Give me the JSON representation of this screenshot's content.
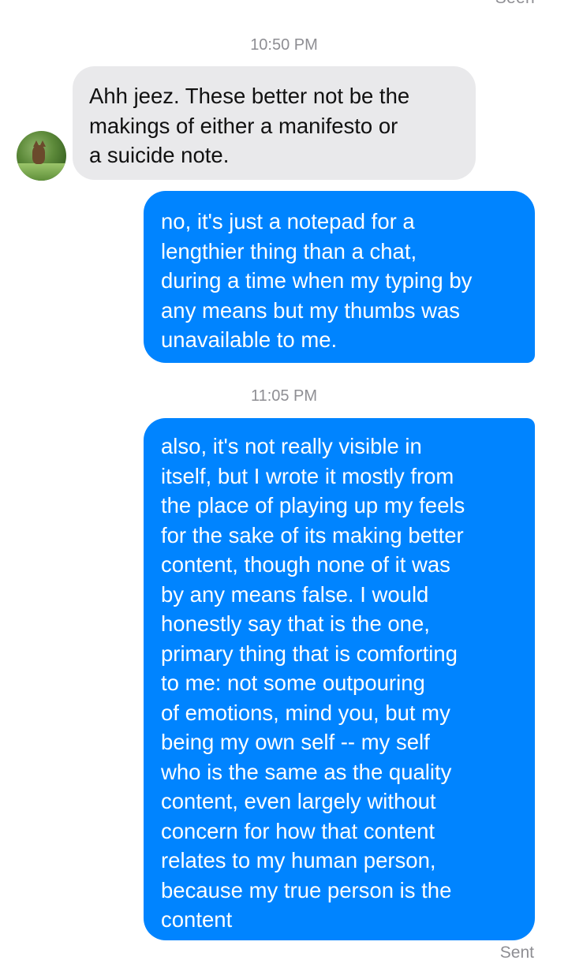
{
  "header": {
    "status_top": "Seen"
  },
  "thread": {
    "timestamp_1": "10:50 PM",
    "incoming_message": "Ahh jeez. These better not be the\nmakings of either a manifesto or\na suicide note.",
    "outgoing_message_1": "no, it's just a notepad for a\nlengthier thing than a chat,\nduring a time when my typing by\nany means but my thumbs was\nunavailable to me.",
    "timestamp_2": "11:05 PM",
    "outgoing_message_2": "also, it's not really visible in\nitself, but I wrote it mostly from\nthe place of playing up my feels\nfor the sake of its making better\ncontent, though none of it was\nby any means false. I would\nhonestly say that is the one,\nprimary thing that is comforting\nto me: not some outpouring\nof emotions, mind you, but my\nbeing my own self -- my self\nwho is the same as the quality\ncontent, even largely without\nconcern for how that content\nrelates to my human person,\nbecause my true person is the\ncontent",
    "sent_status": "Sent"
  },
  "colors": {
    "outgoing_bubble": "#0084ff",
    "incoming_bubble": "#e9e9eb",
    "meta_text": "#8e8e93"
  }
}
